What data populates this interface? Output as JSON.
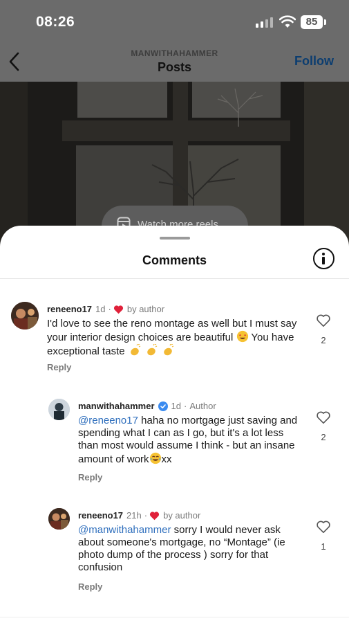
{
  "status": {
    "time": "08:26",
    "battery": "85"
  },
  "nav": {
    "account": "MANWITHAHAMMER",
    "title": "Posts",
    "follow_label": "Follow"
  },
  "post": {
    "watch_reels_label": "Watch more reels"
  },
  "sheet": {
    "title": "Comments"
  },
  "comments": [
    {
      "user": "reneeno17",
      "time": "1d",
      "sep": "·",
      "author_badge": "by author",
      "text_parts": [
        "I'd love to see the reno montage as well but I must say your interior design choices are beautiful",
        " You have exceptional taste "
      ],
      "reply_label": "Reply",
      "likes": "2"
    },
    {
      "user": "manwithahammer",
      "time": "1d",
      "sep": "·",
      "author_badge": "Author",
      "mention": "@reneeno17",
      "text": " haha no mortgage just saving and spending what I can as I go, but it's a lot less than most would assume I think - but an insane amount of work",
      "text_tail": "xx",
      "reply_label": "Reply",
      "likes": "2"
    },
    {
      "user": "reneeno17",
      "time": "21h",
      "sep": "·",
      "author_badge": "by author",
      "mention": "@manwithahammer",
      "text": " sorry I would never ask about someone's mortgage, no “Montage” (ie photo dump of the process ) sorry for that confusion",
      "reply_label": "Reply",
      "likes": "1"
    }
  ],
  "icons": {
    "back": "chevron-left-icon",
    "info": "info-icon",
    "like": "heart-outline-icon",
    "liked_by_author": "heart-filled-icon",
    "verified": "verified-badge-icon",
    "reels": "reels-icon"
  },
  "colors": {
    "accent": "#2f6fbd",
    "heart": "#e0213a",
    "follow": "#0b3d70"
  }
}
